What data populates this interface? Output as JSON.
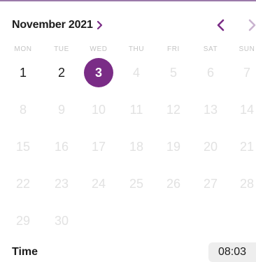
{
  "header": {
    "month_label": "November 2021"
  },
  "weekdays": [
    "MON",
    "TUE",
    "WED",
    "THU",
    "FRI",
    "SAT",
    "SUN"
  ],
  "weeks": [
    [
      "1",
      "2",
      "3",
      "4",
      "5",
      "6",
      "7"
    ],
    [
      "8",
      "9",
      "10",
      "11",
      "12",
      "13",
      "14"
    ],
    [
      "15",
      "16",
      "17",
      "18",
      "19",
      "20",
      "21"
    ],
    [
      "22",
      "23",
      "24",
      "25",
      "26",
      "27",
      "28"
    ],
    [
      "29",
      "30",
      "",
      "",
      "",
      "",
      ""
    ]
  ],
  "selected_day": "3",
  "selectable_days": [
    "1",
    "2",
    "3"
  ],
  "time": {
    "label": "Time",
    "value": "08:03"
  },
  "colors": {
    "accent": "#7a2c86",
    "text": "#1c1c1c",
    "muted_text": "#e2e2e2",
    "weekday_text": "#c4c4c4",
    "time_bg": "#eeeeee"
  },
  "icons": {
    "month_toggle": "chevron-right-icon",
    "prev": "chevron-left-icon",
    "next": "chevron-right-icon"
  }
}
